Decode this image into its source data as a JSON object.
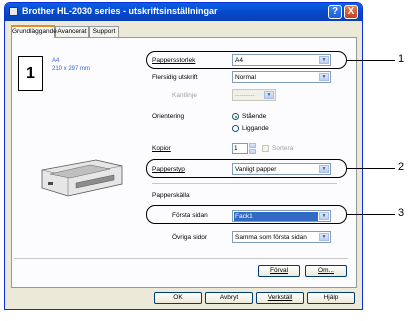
{
  "window": {
    "title": "Brother HL-2030 series - utskriftsinställningar",
    "help_button": "?",
    "close_button": "X"
  },
  "tabs": [
    {
      "label": "Grundläggande",
      "active": true
    },
    {
      "label": "Avancerat",
      "active": false
    },
    {
      "label": "Support",
      "active": false
    }
  ],
  "paper_preview": {
    "copies_number": "1",
    "size_name": "A4",
    "size_dims": "210 x 297 mm"
  },
  "settings": {
    "paper_size": {
      "label": "Pappersstorlek",
      "value": "A4"
    },
    "duplex": {
      "label": "Flersidig utskrift",
      "value": "Normal"
    },
    "border": {
      "label": "Kantlinje",
      "value": "---------"
    },
    "orientation": {
      "label": "Orientering",
      "options": [
        {
          "label": "Stående",
          "selected": true
        },
        {
          "label": "Liggande",
          "selected": false
        }
      ]
    },
    "copies": {
      "label": "Kopior",
      "value": "1",
      "collate_label": "Sortera"
    },
    "media_type": {
      "label": "Papperstyp",
      "value": "Vanligt papper"
    },
    "paper_source_heading": "Papperskälla",
    "first_page": {
      "label": "Första sidan",
      "value": "Fack1"
    },
    "other_pages": {
      "label": "Övriga sidor",
      "value": "Samma som första sidan"
    }
  },
  "panel_buttons": {
    "default": "Förval",
    "about": "Om..."
  },
  "dialog_buttons": {
    "ok": "OK",
    "cancel": "Avbryt",
    "apply": "Verkställ",
    "help": "Hjälp"
  },
  "callouts": {
    "one": "1",
    "two": "2",
    "three": "3"
  }
}
